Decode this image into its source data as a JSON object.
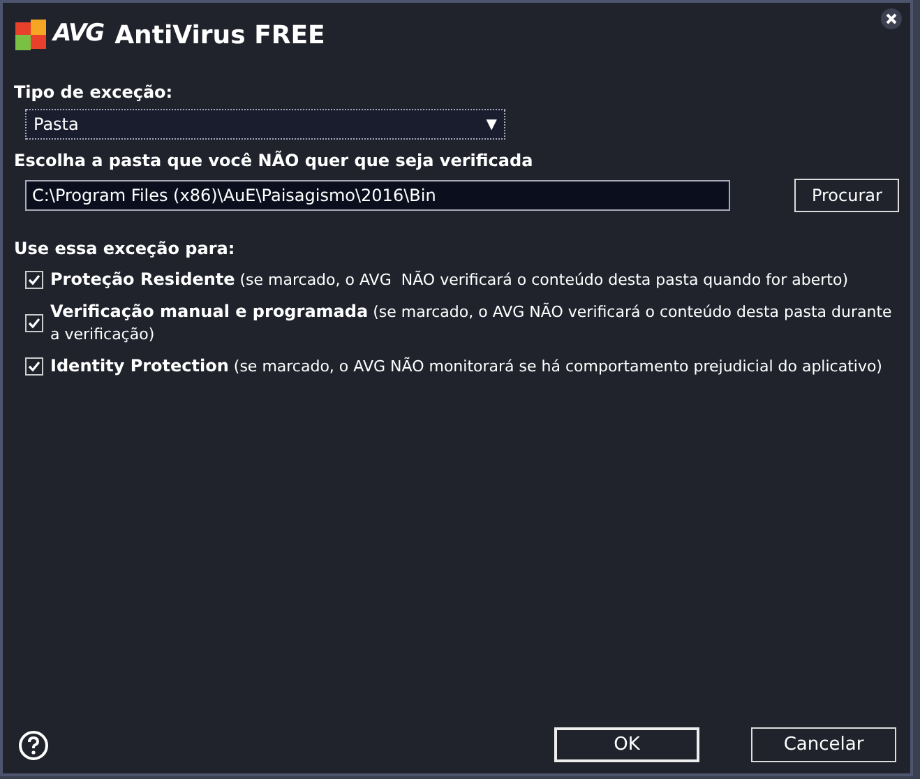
{
  "window": {
    "brand": "AVG",
    "title": "AntiVirus FREE"
  },
  "exception_type": {
    "label": "Tipo de exceção:",
    "value": "Pasta",
    "arrow": "▼"
  },
  "folder": {
    "label": "Escolha a pasta que você NÃO quer que seja verificada",
    "value": "C:\\Program Files (x86)\\AuE\\Paisagismo\\2016\\Bin",
    "browse_button": "Procurar"
  },
  "use_for": {
    "label": "Use essa exceção para:",
    "options": [
      {
        "text": "**Proteção Residente** (se marcado, o AVG  NÃO verificará o conteúdo desta pasta quando for aberto)",
        "checked": true
      },
      {
        "text": "**Verificação manual e programada** (se marcado, o AVG NÃO verificará o conteúdo desta pasta durante a verificação)",
        "checked": true
      },
      {
        "text": "**Identity Protection** (se marcado, o AVG NÃO monitorará se há comportamento prejudicial do aplicativo)",
        "checked": true
      }
    ]
  },
  "buttons": [
    "OK",
    "Cancelar"
  ]
}
